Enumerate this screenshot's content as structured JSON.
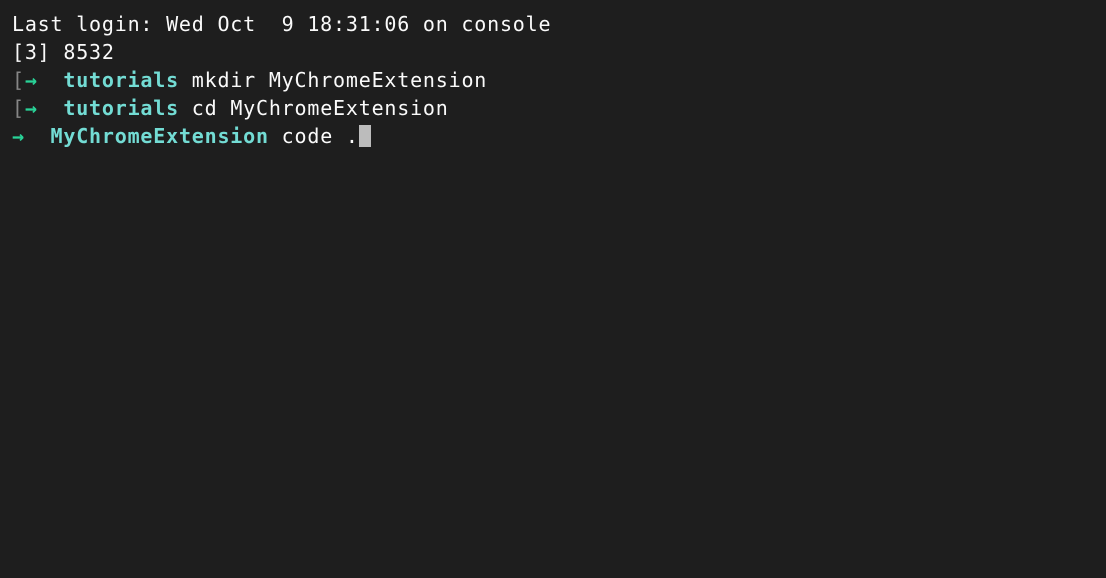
{
  "login_line": "Last login: Wed Oct  9 18:31:06 on console",
  "job_line": "[3] 8532",
  "lines": [
    {
      "bracket_open": "[",
      "arrow": "→  ",
      "dir": "tutorials",
      "command": " mkdir MyChromeExtension"
    },
    {
      "bracket_open": "[",
      "arrow": "→  ",
      "dir": "tutorials",
      "command": " cd MyChromeExtension"
    }
  ],
  "current": {
    "arrow": "→  ",
    "dir": "MyChromeExtension",
    "command": " code ."
  }
}
